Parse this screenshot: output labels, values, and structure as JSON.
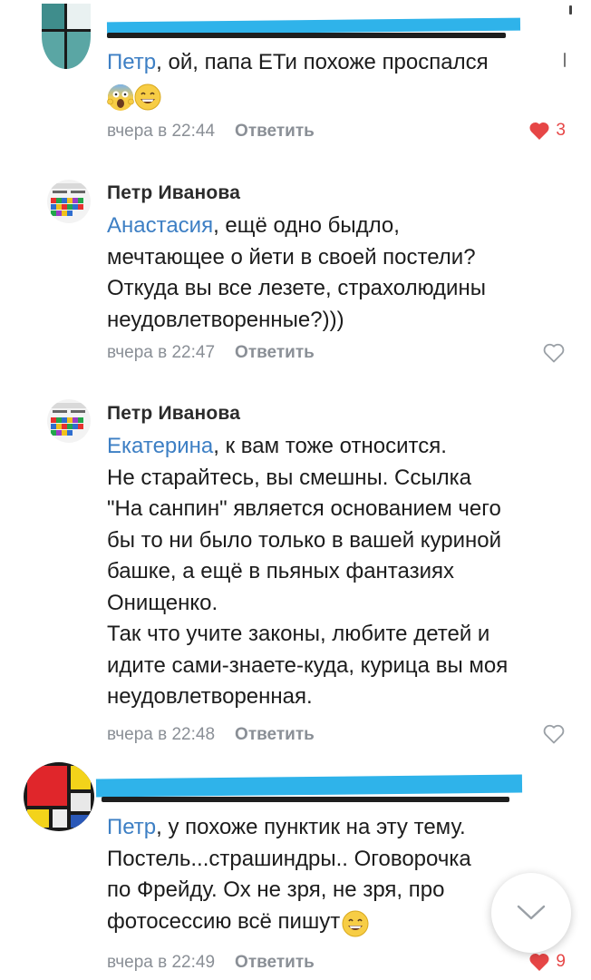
{
  "colors": {
    "mention": "#3d7fc4",
    "meta": "#8a8f96",
    "like": "#e64646",
    "redaction": "#2fb3ea"
  },
  "comments": [
    {
      "author": "",
      "mention": "Петр",
      "text_lines": [
        ", ой, папа ЕТи похоже проспался"
      ],
      "emoji": [
        "scream-emoji",
        "grin-emoji"
      ],
      "time": "вчера в 22:44",
      "reply_label": "Ответить",
      "likes": "3",
      "liked": true
    },
    {
      "author": "Петр Иванова",
      "mention": "Анастасия",
      "text_lines": [
        ", ещё одно быдло,",
        "мечтающее о йети в своей постели?",
        "Откуда вы все лезете, страхолюдины",
        "неудовлетворенные?)))"
      ],
      "time": "вчера в 22:47",
      "reply_label": "Ответить",
      "liked": false
    },
    {
      "author": "Петр Иванова",
      "mention": "Екатерина",
      "text_lines": [
        ", к вам тоже относится.",
        "Не старайтесь, вы смешны. Ссылка",
        "\"На санпин\" является основанием чего",
        "бы то ни было только в вашей куриной",
        "башке, а ещё в пьяных фантазиях",
        "Онищенко.",
        "Так что учите законы, любите детей и",
        "идите сами-знаете-куда, курица вы моя",
        "неудовлетворенная."
      ],
      "time": "вчера в 22:48",
      "reply_label": "Ответить",
      "liked": false
    },
    {
      "author": "",
      "mention": "Петр",
      "text_lines": [
        ", у похоже пунктик на эту тему.",
        "Постель...страшиндры.. Оговорочка",
        "по Фрейду. Ох не зря, не зря, про",
        "фотосессию всё пишут"
      ],
      "emoji": [
        "grin-emoji"
      ],
      "time": "вчера в 22:49",
      "reply_label": "Ответить",
      "likes": "9",
      "liked": true
    }
  ]
}
